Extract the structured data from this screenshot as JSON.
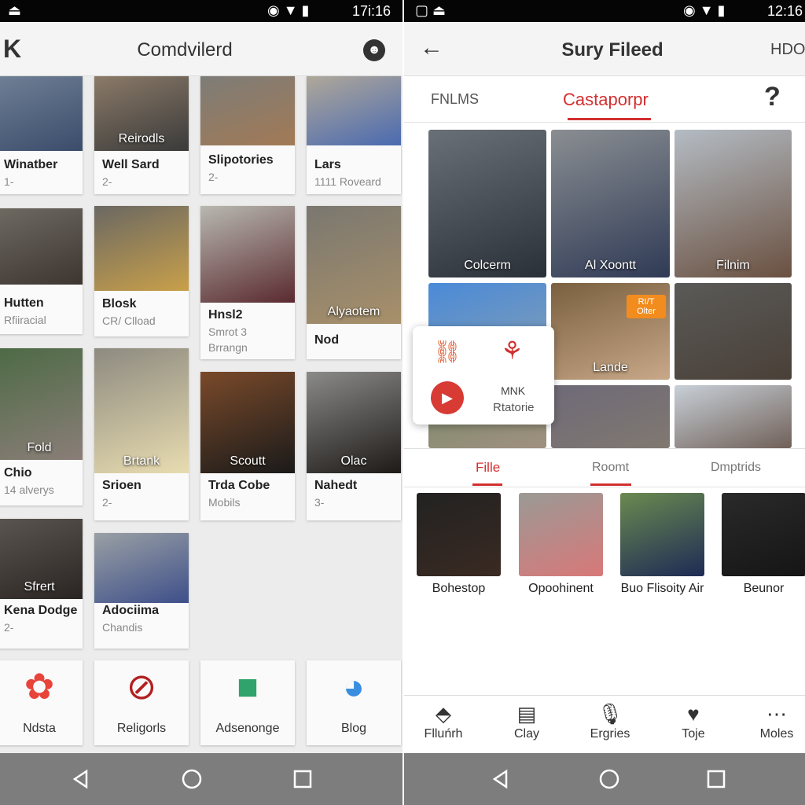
{
  "left": {
    "status": {
      "time": "17i:16"
    },
    "header": {
      "back": "K",
      "title": "Comdvilerd"
    },
    "cards": [
      {
        "title": "Winatber",
        "sub": "1-",
        "overlay": "",
        "colors": [
          "#6f7f95",
          "#3b4c6b"
        ]
      },
      {
        "title": "Hutten",
        "sub": "Rfiiracial",
        "overlay": "",
        "colors": [
          "#6e6a62",
          "#3d3530"
        ]
      },
      {
        "title": "Chio",
        "sub": "14 alverys",
        "overlay": "Fold",
        "colors": [
          "#4d6a45",
          "#8a7e78"
        ]
      },
      {
        "title": "Kena Dodge",
        "sub": "2-",
        "overlay": "Sfrert",
        "colors": [
          "#5a5550",
          "#2a2522"
        ]
      },
      {
        "title": "Well Sard",
        "sub": "2-",
        "overlay": "Reirodls",
        "colors": [
          "#8b7a68",
          "#3a3a3a"
        ]
      },
      {
        "title": "Blosk",
        "sub": "CR/ Clload",
        "overlay": "",
        "colors": [
          "#6a6862",
          "#c9a04a"
        ]
      },
      {
        "title": "Srioen",
        "sub": "2-",
        "overlay": "Brtank",
        "colors": [
          "#8d8a80",
          "#e8dcb0"
        ]
      },
      {
        "title": "Adociima",
        "sub": "Chandis",
        "overlay": "",
        "colors": [
          "#9aa0a4",
          "#3e4f8a"
        ]
      },
      {
        "title": "Slipotories",
        "sub": "2-",
        "overlay": "",
        "colors": [
          "#7d7c78",
          "#a27a55"
        ]
      },
      {
        "title": "Hnsl2",
        "sub": "Smrot 3",
        "sub2": "Brrangn",
        "overlay": "",
        "colors": [
          "#b8b8b0",
          "#5a2a30"
        ]
      },
      {
        "title": "Trda Cobe",
        "sub": "Mobils",
        "overlay": "Scoutt",
        "colors": [
          "#7a4a2a",
          "#1a1a1a"
        ]
      },
      {
        "title": "Lars",
        "sub": "1111 Roveard",
        "overlay": "",
        "colors": [
          "#b0a89a",
          "#4a6ab0"
        ]
      },
      {
        "title": "Nod",
        "sub": "",
        "overlay": "Alyaotem",
        "colors": [
          "#7a7770",
          "#a8906a"
        ]
      },
      {
        "title": "Nahedt",
        "sub": "3-",
        "overlay": "Olac",
        "colors": [
          "#8a8a88",
          "#1e1a18"
        ]
      }
    ],
    "apps": [
      {
        "label": "Ndsta",
        "icon": "flower-icon"
      },
      {
        "label": "Religorls",
        "icon": "no-food-icon"
      },
      {
        "label": "Adsenonge",
        "icon": "video-camera-icon"
      },
      {
        "label": "Blog",
        "icon": "pie-chart-icon"
      }
    ]
  },
  "right": {
    "status": {
      "time": "12:16"
    },
    "header": {
      "title": "Sury Fileed",
      "action": "HDO"
    },
    "tabs": [
      {
        "label": "FNLMS"
      },
      {
        "label": "Castaporpr",
        "active": true
      }
    ],
    "help": "?",
    "grid": [
      {
        "overlay": "Colcerm",
        "colors": [
          "#6a7078",
          "#2a3038"
        ]
      },
      {
        "overlay": "Al Xoontt",
        "colors": [
          "#8a8e92",
          "#2f3a55"
        ]
      },
      {
        "overlay": "Filnim",
        "colors": [
          "#b4bcc4",
          "#6a5040"
        ]
      },
      {
        "overlay": "",
        "colors": [
          "#4a8ad8",
          "#8aa0b0"
        ]
      },
      {
        "overlay": "Lande",
        "colors": [
          "#7a6040",
          "#c8a888"
        ],
        "badge": "RI/T Olter"
      },
      {
        "overlay": "",
        "colors": [
          "#5a5a58",
          "#4a4038"
        ]
      },
      {
        "overlay": "",
        "colors": [
          "#7a8a6a",
          "#a09080"
        ]
      },
      {
        "overlay": "",
        "colors": [
          "#6e6a78",
          "#807870"
        ]
      },
      {
        "overlay": "",
        "colors": [
          "#c8d0d8",
          "#706058"
        ]
      }
    ],
    "popup": {
      "line1": "MNK",
      "line2": "Rtatorie"
    },
    "subtabs": [
      {
        "label": "Fille",
        "active": true
      },
      {
        "label": "Roomt"
      },
      {
        "label": "Dmptrids"
      }
    ],
    "people": [
      {
        "label": "Bohestop",
        "colors": [
          "#222",
          "#3a2a22"
        ]
      },
      {
        "label": "Opoohinent",
        "colors": [
          "#9a9a96",
          "#d87878"
        ]
      },
      {
        "label": "Buo Flisoity Air",
        "colors": [
          "#6a8a50",
          "#1e2a55"
        ]
      },
      {
        "label": "Beunor",
        "colors": [
          "#2a2a2a",
          "#151515"
        ]
      }
    ],
    "bottom_nav": [
      {
        "label": "Flluńrh",
        "icon": "layers-icon"
      },
      {
        "label": "Clay",
        "icon": "calendar-icon"
      },
      {
        "label": "Ergries",
        "icon": "microphone-icon"
      },
      {
        "label": "Toje",
        "icon": "heart-icon"
      },
      {
        "label": "Moles",
        "icon": "more-icon"
      }
    ]
  },
  "accent": "#d32f2f"
}
